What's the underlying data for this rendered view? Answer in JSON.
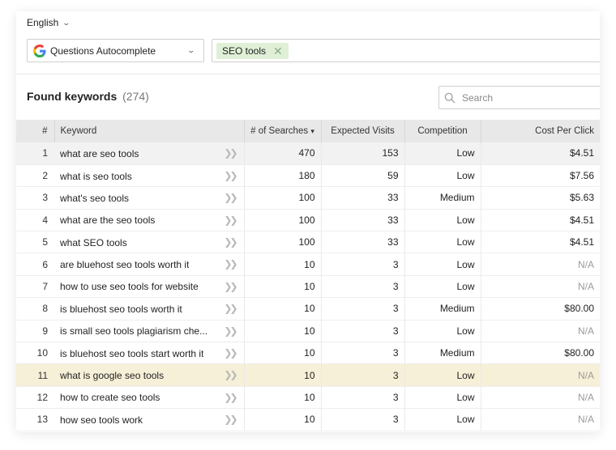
{
  "language": {
    "label": "English"
  },
  "source_select": {
    "label": "Questions Autocomplete"
  },
  "keyword_tags": [
    {
      "label": "SEO tools"
    }
  ],
  "found": {
    "title": "Found keywords",
    "count": "(274)"
  },
  "search": {
    "placeholder": "Search"
  },
  "table": {
    "columns": [
      "#",
      "Keyword",
      "# of Searches",
      "Expected Visits",
      "Competition",
      "Cost Per Click"
    ],
    "rows": [
      {
        "n": "1",
        "keyword": "what are seo tools",
        "searches": "470",
        "visits": "153",
        "competition": "Low",
        "cpc": "$4.51",
        "cpc_na": false
      },
      {
        "n": "2",
        "keyword": "what is seo tools",
        "searches": "180",
        "visits": "59",
        "competition": "Low",
        "cpc": "$7.56",
        "cpc_na": false
      },
      {
        "n": "3",
        "keyword": "what's seo tools",
        "searches": "100",
        "visits": "33",
        "competition": "Medium",
        "cpc": "$5.63",
        "cpc_na": false
      },
      {
        "n": "4",
        "keyword": "what are the seo tools",
        "searches": "100",
        "visits": "33",
        "competition": "Low",
        "cpc": "$4.51",
        "cpc_na": false
      },
      {
        "n": "5",
        "keyword": "what SEO tools",
        "searches": "100",
        "visits": "33",
        "competition": "Low",
        "cpc": "$4.51",
        "cpc_na": false
      },
      {
        "n": "6",
        "keyword": "are bluehost seo tools worth it",
        "searches": "10",
        "visits": "3",
        "competition": "Low",
        "cpc": "N/A",
        "cpc_na": true
      },
      {
        "n": "7",
        "keyword": "how to use seo tools for website",
        "searches": "10",
        "visits": "3",
        "competition": "Low",
        "cpc": "N/A",
        "cpc_na": true
      },
      {
        "n": "8",
        "keyword": "is bluehost seo tools worth it",
        "searches": "10",
        "visits": "3",
        "competition": "Medium",
        "cpc": "$80.00",
        "cpc_na": false
      },
      {
        "n": "9",
        "keyword": "is small seo tools plagiarism che...",
        "searches": "10",
        "visits": "3",
        "competition": "Low",
        "cpc": "N/A",
        "cpc_na": true
      },
      {
        "n": "10",
        "keyword": "is bluehost seo tools start worth it",
        "searches": "10",
        "visits": "3",
        "competition": "Medium",
        "cpc": "$80.00",
        "cpc_na": false
      },
      {
        "n": "11",
        "keyword": "what is google seo tools",
        "searches": "10",
        "visits": "3",
        "competition": "Low",
        "cpc": "N/A",
        "cpc_na": true
      },
      {
        "n": "12",
        "keyword": "how to create seo tools",
        "searches": "10",
        "visits": "3",
        "competition": "Low",
        "cpc": "N/A",
        "cpc_na": true
      },
      {
        "n": "13",
        "keyword": "how seo tools work",
        "searches": "10",
        "visits": "3",
        "competition": "Low",
        "cpc": "N/A",
        "cpc_na": true
      }
    ],
    "highlighted_rows": {
      "grey": 0,
      "yellow": 10
    },
    "sort_indicator": "▾"
  },
  "colors": {
    "tag_bg": "#dff0d6",
    "highlight_yellow": "#f7f0d8",
    "header_bg": "#e8e8e8"
  },
  "icons": {
    "google": "google-icon",
    "search": "search-icon",
    "arrows": "double-chevron-right-icon"
  }
}
